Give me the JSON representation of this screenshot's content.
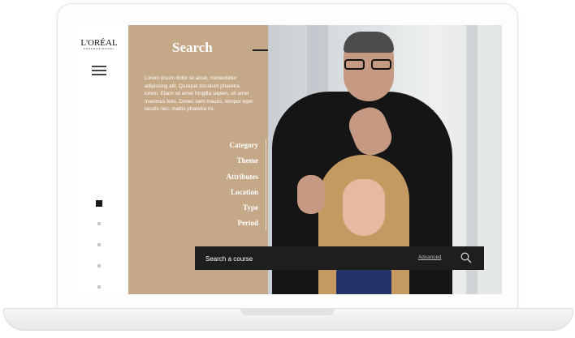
{
  "brand": {
    "logo": "L'ORÉAL",
    "logo_sub": "PROFESSIONNEL"
  },
  "panel": {
    "title": "Search",
    "description": "Lorem ipsum dolor sit amet, consectetur adipiscing elit. Quisque tincidunt pharetra lorem. Etiam sit amet fringilla sapien, sit amet maximus felis. Donec sem mauris, tempor eget iaculis nec, mattis pharetra mi.",
    "filters": [
      "Category",
      "Theme",
      "Attributes",
      "Location",
      "Type",
      "Period"
    ]
  },
  "search": {
    "placeholder": "Search a course",
    "advanced_label": "Advanced"
  },
  "pagination": {
    "count": 5,
    "active_index": 0
  },
  "colors": {
    "panel": "#c4a887",
    "search_bar": "#1e1e1e"
  }
}
